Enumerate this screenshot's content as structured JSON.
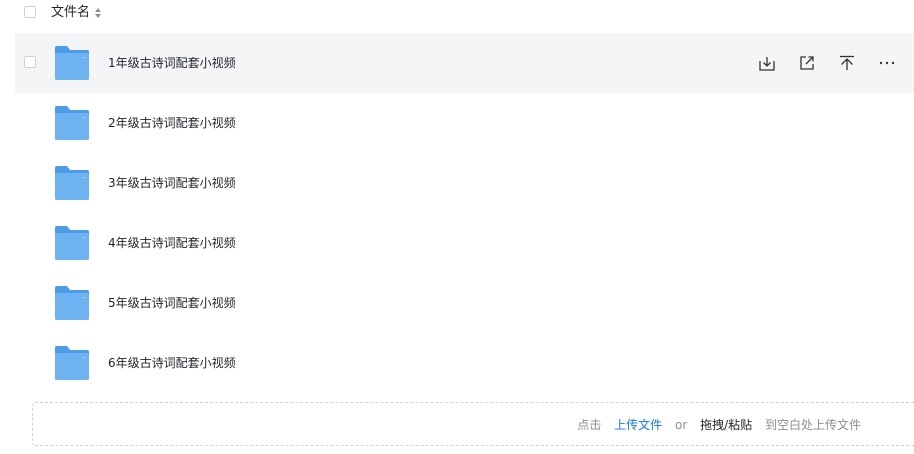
{
  "header": {
    "filename_label": "文件名"
  },
  "rows": [
    {
      "name": "1年级古诗词配套小视频"
    },
    {
      "name": "2年级古诗词配套小视频"
    },
    {
      "name": "3年级古诗词配套小视频"
    },
    {
      "name": "4年级古诗词配套小视频"
    },
    {
      "name": "5年级古诗词配套小视频"
    },
    {
      "name": "6年级古诗词配套小视频"
    }
  ],
  "row_actions": {
    "download_icon": "download-icon",
    "share_icon": "share-icon",
    "pin_top_icon": "pin-to-top-icon",
    "more_icon": "more-icon"
  },
  "dropzone": {
    "click_label": "点击",
    "upload_link": "上传文件",
    "or_label": "or",
    "drag_label": "拖拽/粘贴",
    "tail_label": "到空白处上传文件"
  },
  "colors": {
    "folder": "#6db3f2",
    "folder_back": "#4a9be8",
    "accent_link": "#1677ff",
    "hover_row": "#f4f5f6"
  }
}
